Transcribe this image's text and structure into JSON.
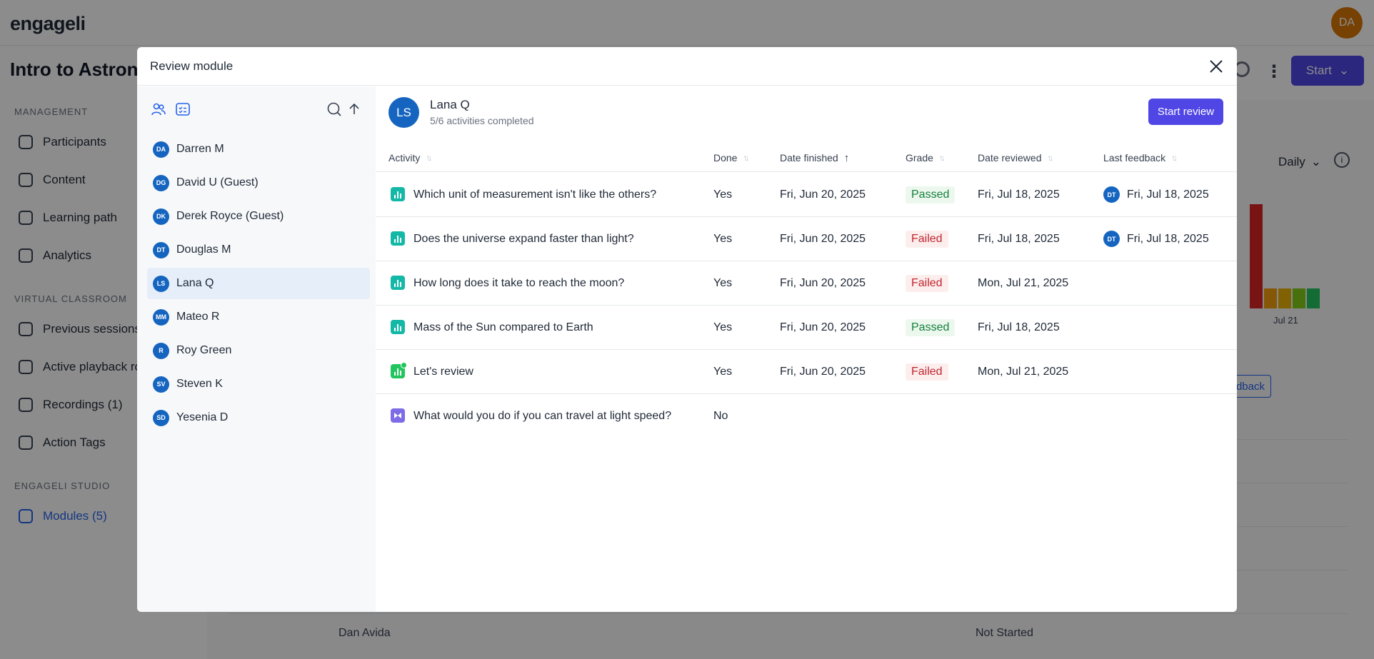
{
  "app": {
    "logo": "engageli",
    "user_initials": "DA",
    "course_title": "Intro to Astronon",
    "start_label": "Start"
  },
  "sidebar": {
    "sections": [
      {
        "heading": "MANAGEMENT",
        "items": [
          {
            "label": "Participants",
            "icon": "users-icon"
          },
          {
            "label": "Content",
            "icon": "content-icon"
          },
          {
            "label": "Learning path",
            "icon": "book-icon"
          },
          {
            "label": "Analytics",
            "icon": "analytics-icon"
          }
        ]
      },
      {
        "heading": "VIRTUAL CLASSROOM",
        "items": [
          {
            "label": "Previous sessions",
            "icon": "sessions-icon"
          },
          {
            "label": "Active playback ro",
            "icon": "playback-icon"
          },
          {
            "label": "Recordings (1)",
            "icon": "recording-icon"
          },
          {
            "label": "Action Tags",
            "icon": "tag-icon"
          }
        ]
      },
      {
        "heading": "ENGAGELI STUDIO",
        "items": [
          {
            "label": "Modules (5)",
            "icon": "module-icon",
            "active": true
          }
        ]
      }
    ]
  },
  "background": {
    "period_select": "Daily",
    "axis_tick": "Jul 21",
    "feedback_label": "dback",
    "row_name": "Dan Avida",
    "row_status": "Not Started"
  },
  "modal": {
    "title": "Review module",
    "participants": [
      {
        "initials": "DA",
        "name": "Darren M"
      },
      {
        "initials": "DG",
        "name": "David U (Guest)"
      },
      {
        "initials": "DK",
        "name": "Derek Royce (Guest)"
      },
      {
        "initials": "DT",
        "name": "Douglas M"
      },
      {
        "initials": "LS",
        "name": "Lana Q",
        "selected": true
      },
      {
        "initials": "MM",
        "name": "Mateo R"
      },
      {
        "initials": "R",
        "name": "Roy Green"
      },
      {
        "initials": "SV",
        "name": "Steven K"
      },
      {
        "initials": "SD",
        "name": "Yesenia D"
      }
    ],
    "selected_user": {
      "initials": "LS",
      "name": "Lana Q",
      "progress": "5/6 activities completed"
    },
    "start_review_label": "Start review",
    "columns": {
      "activity": "Activity",
      "done": "Done",
      "date_finished": "Date finished",
      "grade": "Grade",
      "date_reviewed": "Date reviewed",
      "last_feedback": "Last feedback"
    },
    "rows": [
      {
        "activity": "Which unit of measurement isn't like the others?",
        "icon": "poll-icon",
        "done": "Yes",
        "date_finished": "Fri, Jun 20, 2025",
        "grade": "Passed",
        "date_reviewed": "Fri, Jul 18, 2025",
        "feedback_initials": "DT",
        "last_feedback": "Fri, Jul 18, 2025"
      },
      {
        "activity": "Does the universe expand faster than light?",
        "icon": "poll-icon",
        "done": "Yes",
        "date_finished": "Fri, Jun 20, 2025",
        "grade": "Failed",
        "date_reviewed": "Fri, Jul 18, 2025",
        "feedback_initials": "DT",
        "last_feedback": "Fri, Jul 18, 2025"
      },
      {
        "activity": "How long does it take to reach the moon?",
        "icon": "poll-icon",
        "done": "Yes",
        "date_finished": "Fri, Jun 20, 2025",
        "grade": "Failed",
        "date_reviewed": "Mon, Jul 21, 2025",
        "feedback_initials": "",
        "last_feedback": ""
      },
      {
        "activity": "Mass of the Sun compared to Earth",
        "icon": "poll-icon",
        "done": "Yes",
        "date_finished": "Fri, Jun 20, 2025",
        "grade": "Passed",
        "date_reviewed": "Fri, Jul 18, 2025",
        "feedback_initials": "",
        "last_feedback": ""
      },
      {
        "activity": "Let's review",
        "icon": "review-poll-icon",
        "done": "Yes",
        "date_finished": "Fri, Jun 20, 2025",
        "grade": "Failed",
        "date_reviewed": "Mon, Jul 21, 2025",
        "feedback_initials": "",
        "last_feedback": ""
      },
      {
        "activity": "What would you do if you can travel at light speed?",
        "icon": "video-response-icon",
        "done": "No",
        "date_finished": "",
        "grade": "",
        "date_reviewed": "",
        "feedback_initials": "",
        "last_feedback": ""
      }
    ]
  },
  "colors": {
    "primary": "#4f46e5",
    "avatar_blue": "#1565c0",
    "passed_text": "#15803d",
    "failed_text": "#c0262d",
    "poll_icon": "#14b8a6",
    "video_icon": "#7c6ce6"
  }
}
